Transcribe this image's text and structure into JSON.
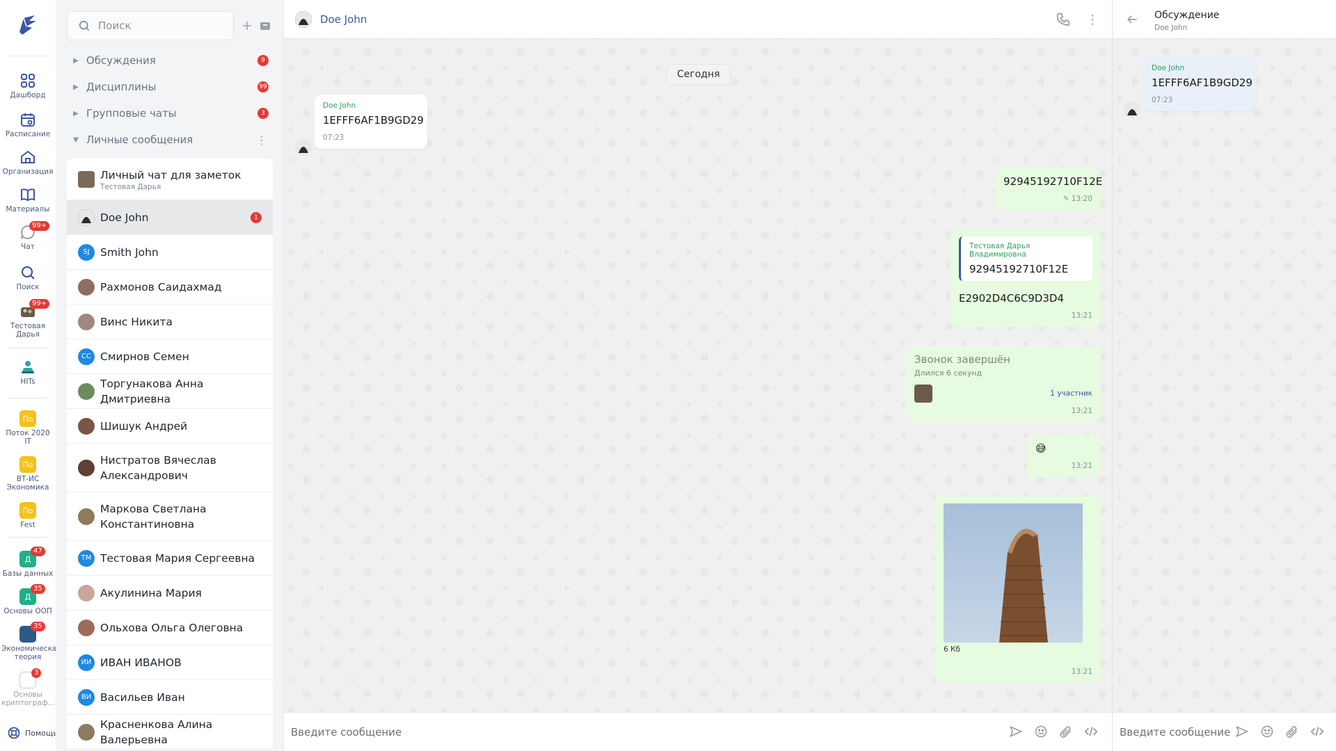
{
  "rail": {
    "items": [
      {
        "label": "Дашборд",
        "icon": "dashboard-icon"
      },
      {
        "label": "Расписание",
        "icon": "calendar-icon"
      },
      {
        "label": "Организация",
        "icon": "home-icon"
      },
      {
        "label": "Материалы",
        "icon": "book-icon"
      },
      {
        "label": "Чат",
        "icon": "chat-icon",
        "badge": "99+"
      },
      {
        "label": "Поиск",
        "icon": "search-icon"
      },
      {
        "label": "Тестовая Дарья",
        "icon": "user-avatar",
        "badge": "99+"
      },
      {
        "label": "HITs",
        "icon": "hits-icon"
      }
    ],
    "groups": [
      {
        "label": "Поток 2020 IT",
        "short": "По",
        "color": "#f3c21b"
      },
      {
        "label": "ВТ-ИС Экономика",
        "short": "По",
        "color": "#f3c21b"
      },
      {
        "label": "Fest",
        "short": "По",
        "color": "#f3c21b"
      },
      {
        "label": "Базы данных",
        "short": "Д",
        "color": "#1fb08a",
        "badge": "47"
      },
      {
        "label": "Основы ООП",
        "short": "Д",
        "color": "#1fb08a",
        "badge": "35"
      },
      {
        "label": "Экономическая теория",
        "short": "",
        "color": "#2c5a86",
        "badge": "35"
      },
      {
        "label": "Основы криптограф...",
        "short": "",
        "color": "#ffffff",
        "badge": "3"
      }
    ],
    "help_label": "Помощь"
  },
  "panel": {
    "search_placeholder": "Поиск",
    "folders": [
      {
        "title": "Обсуждения",
        "badge": "9"
      },
      {
        "title": "Дисциплины",
        "badge": "99"
      },
      {
        "title": "Групповые чаты",
        "badge": "3"
      },
      {
        "title": "Личные сообщения",
        "badge": ""
      }
    ],
    "chats": [
      {
        "name": "Личный чат для заметок",
        "sub": "Тестовая Дарья",
        "initials": "",
        "color": "#7a6a5a"
      },
      {
        "name": "Doe John",
        "unread": "1",
        "initials": "",
        "color": "#3a3a3a"
      },
      {
        "name": "Smith John",
        "initials": "SJ",
        "color": "#1e88e5"
      },
      {
        "name": "Рахмонов Саидахмад",
        "initials": "",
        "color": "#8d6e63"
      },
      {
        "name": "Винс Никита",
        "initials": "",
        "color": "#a1887f"
      },
      {
        "name": "Смирнов Семен",
        "initials": "СС",
        "color": "#1e88e5"
      },
      {
        "name": "Торгунакова Анна Дмитриевна",
        "initials": "",
        "color": "#6d8b5e"
      },
      {
        "name": "Шишук Андрей",
        "initials": "",
        "color": "#795548"
      },
      {
        "name": "Нистратов Вячеслав Александрович",
        "initials": "",
        "color": "#5d4037"
      },
      {
        "name": "Маркова Светлана Константиновна",
        "initials": "",
        "color": "#8d7b5a"
      },
      {
        "name": "Тестовая Мария Сергеевна",
        "initials": "ТМ",
        "color": "#1e88e5"
      },
      {
        "name": "Акулинина Мария",
        "initials": "",
        "color": "#c9a59a"
      },
      {
        "name": "Ольхова Ольга Олеговна",
        "initials": "",
        "color": "#9c6b5a"
      },
      {
        "name": "ИВАН ИВАНОВ",
        "initials": "ИИ",
        "color": "#1e88e5"
      },
      {
        "name": "Васильев Иван",
        "initials": "ВИ",
        "color": "#1e88e5"
      },
      {
        "name": "Красненкова Алина Валерьевна",
        "initials": "",
        "color": "#8a7a60"
      }
    ]
  },
  "chat": {
    "title": "Doe John",
    "date_chip": "Сегодня",
    "messages": {
      "m1": {
        "author": "Doe John",
        "text": "1EFFF6AF1B9GD29",
        "time": "07:23"
      },
      "m2": {
        "text": "92945192710F12E",
        "time": "13:20"
      },
      "m3": {
        "quote_author": "Тестовая Дарья Владимировна",
        "quote_text": "92945192710F12E",
        "text": "E2902D4C6C9D3D4",
        "time": "13:21"
      },
      "m4": {
        "title": "Звонок завершён",
        "sub": "Длился 6 секунд",
        "participants": "1 участник",
        "time": "13:21"
      },
      "m5": {
        "text": "😅",
        "time": "13:21"
      },
      "m6": {
        "size": "6 Кб",
        "time": "13:21"
      }
    },
    "composer_placeholder": "Введите сообщение"
  },
  "thread": {
    "title": "Обсуждение",
    "subtitle": "Doe John",
    "message": {
      "author": "Doe John",
      "text": "1EFFF6AF1B9GD29",
      "time": "07:23"
    },
    "composer_placeholder": "Введите сообщение"
  },
  "colors": {
    "accent": "#3b57a6",
    "badge": "#e53935",
    "outgoing": "#e6fbdf",
    "author": "#2ea35a"
  }
}
